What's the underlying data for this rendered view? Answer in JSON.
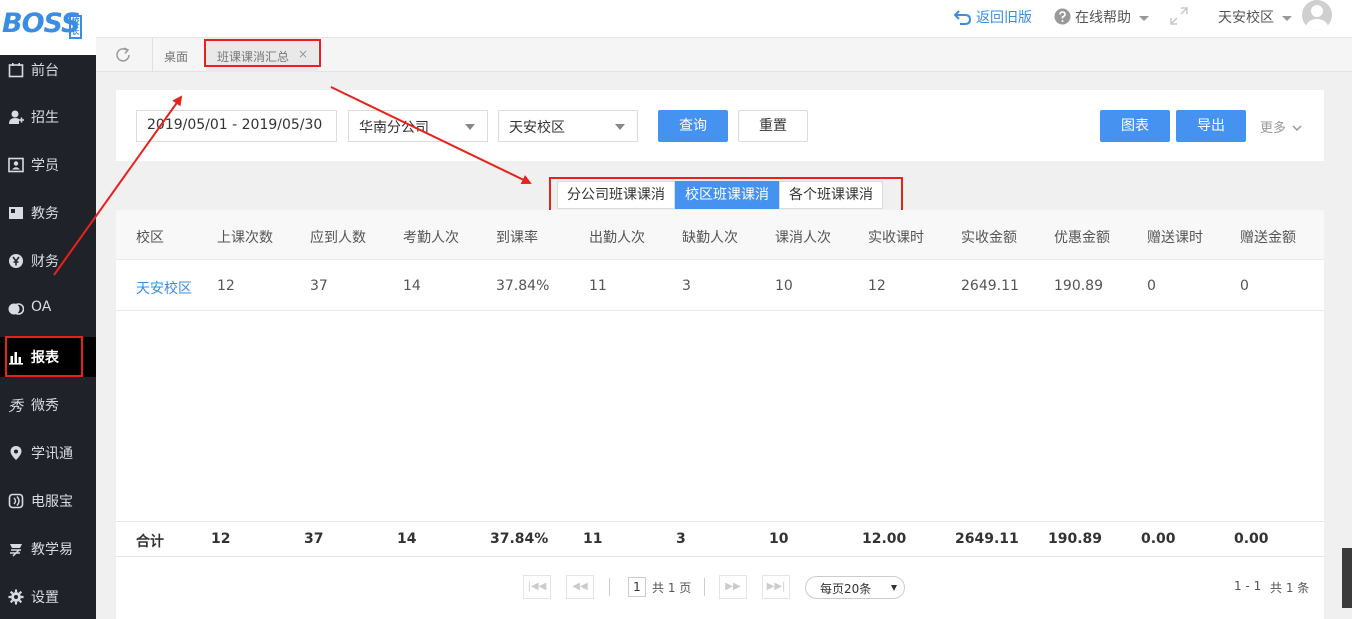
{
  "logo": {
    "text": "BOSS",
    "seal": "校长"
  },
  "sidebar": {
    "items": [
      {
        "label": "前台",
        "icon": "calendar-icon"
      },
      {
        "label": "招生",
        "icon": "add-user-icon"
      },
      {
        "label": "学员",
        "icon": "id-card-icon"
      },
      {
        "label": "教务",
        "icon": "book-icon"
      },
      {
        "label": "财务",
        "icon": "yen-icon"
      },
      {
        "label": "OA",
        "icon": "oa-icon"
      },
      {
        "label": "报表",
        "icon": "bar-chart-icon",
        "active": true
      },
      {
        "label": "微秀",
        "icon": "weixiu-icon"
      },
      {
        "label": "学讯通",
        "icon": "location-icon"
      },
      {
        "label": "电服宝",
        "icon": "phone-service-icon"
      },
      {
        "label": "教学易",
        "icon": "teach-icon"
      },
      {
        "label": "设置",
        "icon": "gear-icon"
      }
    ]
  },
  "topbar": {
    "back_old": "返回旧版",
    "help": "在线帮助",
    "campus": "天安校区"
  },
  "tabs": {
    "desktop": "桌面",
    "current": "班课课消汇总",
    "close": "×"
  },
  "filters": {
    "date_range": "2019/05/01 - 2019/05/30",
    "company": "华南分公司",
    "campus": "天安校区",
    "query": "查询",
    "reset": "重置",
    "chart": "图表",
    "export": "导出",
    "more": "更多"
  },
  "segments": [
    {
      "label": "分公司班课课消",
      "active": false
    },
    {
      "label": "校区班课课消",
      "active": true
    },
    {
      "label": "各个班课课消",
      "active": false
    }
  ],
  "table": {
    "columns": [
      "校区",
      "上课次数",
      "应到人数",
      "考勤人次",
      "到课率",
      "出勤人次",
      "缺勤人次",
      "课消人次",
      "实收课时",
      "实收金额",
      "优惠金额",
      "赠送课时",
      "赠送金额"
    ],
    "rows": [
      [
        "天安校区",
        "12",
        "37",
        "14",
        "37.84%",
        "11",
        "3",
        "10",
        "12",
        "2649.11",
        "190.89",
        "0",
        "0"
      ]
    ],
    "footer": [
      "合计",
      "12",
      "37",
      "14",
      "37.84%",
      "11",
      "3",
      "10",
      "12.00",
      "2649.11",
      "190.89",
      "0.00",
      "0.00"
    ]
  },
  "pager": {
    "page": "1",
    "total_pages": "共 1 页",
    "per_page": "每页20条",
    "range": "1 - 1",
    "total": "共 1 条"
  },
  "colors": {
    "accent": "#4592f0",
    "annotation": "#e8211c",
    "sidebar": "#1f2329"
  }
}
